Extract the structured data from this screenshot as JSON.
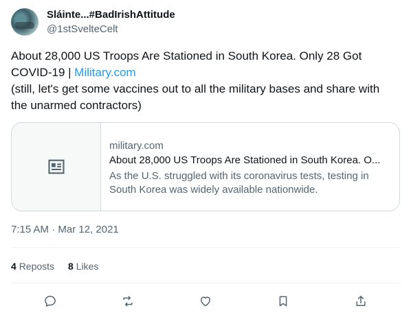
{
  "author": {
    "display_name": "Sláinte...#BadIrishAttitude",
    "handle": "@1stSvelteCelt"
  },
  "tweet": {
    "line1": "About 28,000 US Troops Are Stationed in South Korea. Only 28 Got",
    "line2_text": "COVID-19 | ",
    "line2_link": "Military.com",
    "line3": "(still, let's get some vaccines out to all the military bases and share with",
    "line4": "the unarmed contractors)"
  },
  "card": {
    "domain": "military.com",
    "title": "About 28,000 US Troops Are Stationed in South Korea. O...",
    "description": "As the U.S. struggled with its coronavirus tests, testing in South Korea was widely available nationwide.",
    "thumb_icon": "news-article-icon"
  },
  "meta": {
    "timestamp": "7:15 AM · Mar 12, 2021"
  },
  "stats": {
    "reposts_count": "4",
    "reposts_label": "Reposts",
    "likes_count": "8",
    "likes_label": "Likes"
  },
  "actions": {
    "icons": [
      "reply-icon",
      "repost-icon",
      "like-icon",
      "bookmark-icon",
      "share-icon"
    ]
  },
  "colors": {
    "text": "#0f1419",
    "secondary": "#536471",
    "link": "#1d9bf0",
    "border": "#cfd9de"
  }
}
